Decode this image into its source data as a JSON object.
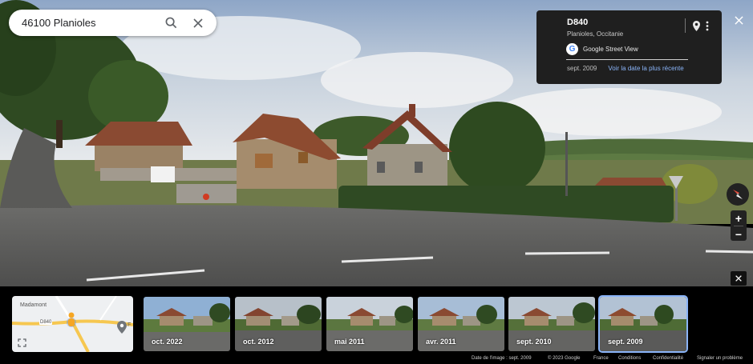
{
  "search": {
    "value": "46100 Planioles"
  },
  "info_card": {
    "title": "D840",
    "subtitle": "Planioles, Occitanie",
    "source": "Google Street View",
    "date": "sept. 2009",
    "latest_link": "Voir la date la plus récente"
  },
  "controls": {
    "zoom_in": "+",
    "zoom_out": "−"
  },
  "minimap": {
    "place_label": "Madamont",
    "road_label": "D840",
    "edge_label": "F"
  },
  "timeline": [
    {
      "label": "oct. 2022",
      "selected": false
    },
    {
      "label": "oct. 2012",
      "selected": false
    },
    {
      "label": "mai 2011",
      "selected": false
    },
    {
      "label": "avr. 2011",
      "selected": false
    },
    {
      "label": "sept. 2010",
      "selected": false
    },
    {
      "label": "sept. 2009",
      "selected": true
    }
  ],
  "footer": {
    "image_date": "Date de l'image : sept. 2009",
    "copyright": "© 2023 Google",
    "country": "France",
    "terms": "Conditions",
    "privacy": "Confidentialité",
    "report": "Signaler un problème"
  },
  "colors": {
    "accent": "#8ab4f8",
    "card_bg": "#1f1f1f",
    "strip_bg": "#000000"
  }
}
